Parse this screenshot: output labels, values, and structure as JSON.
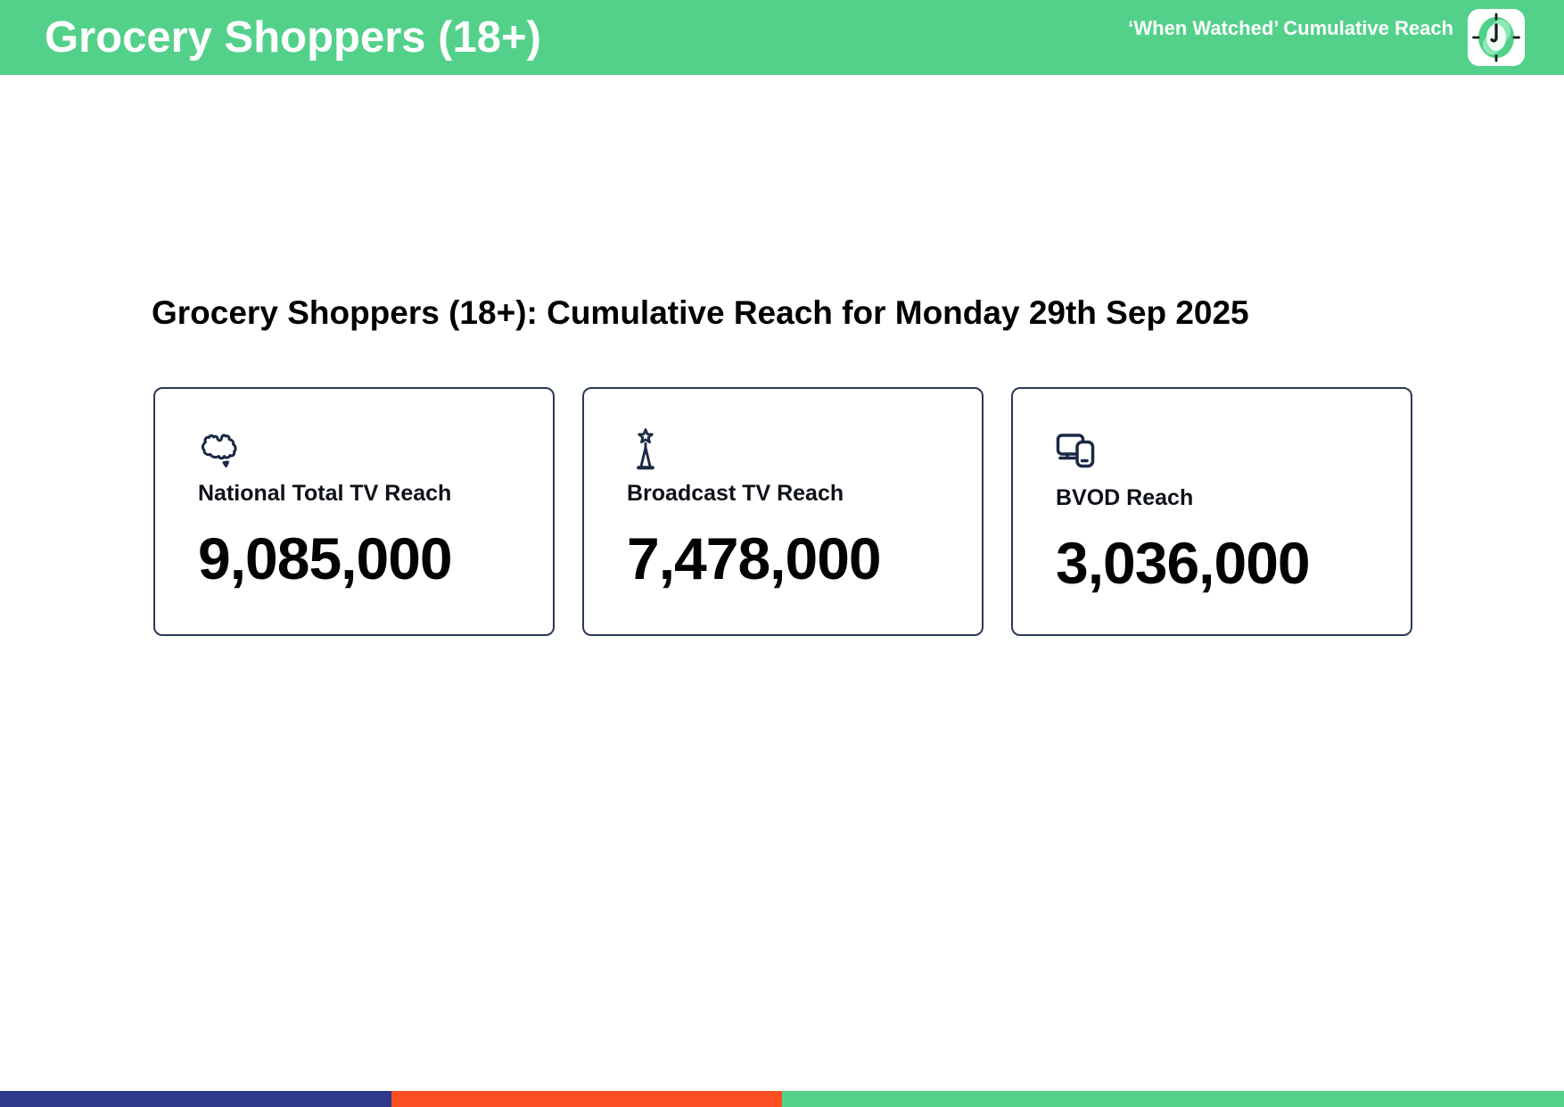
{
  "header": {
    "title": "Grocery Shoppers (18+)",
    "subtitle": "‘When Watched’ Cumulative Reach",
    "logo_icon": "clock-icon"
  },
  "main": {
    "title": "Grocery Shoppers (18+): Cumulative Reach for Monday 29th Sep 2025",
    "cards": [
      {
        "icon": "australia-map-icon",
        "label": "National Total TV Reach",
        "value": "9,085,000"
      },
      {
        "icon": "broadcast-tower-icon",
        "label": "Broadcast TV Reach",
        "value": "7,478,000"
      },
      {
        "icon": "devices-icon",
        "label": "BVOD Reach",
        "value": "3,036,000"
      }
    ]
  },
  "footer": {
    "segments": [
      {
        "name": "navy",
        "color": "#2d3a8c",
        "width_percent": 25
      },
      {
        "name": "orange",
        "color": "#fb4f23",
        "width_percent": 25
      },
      {
        "name": "green",
        "color": "#53d18a",
        "width_percent": 50
      }
    ]
  },
  "colors": {
    "header_bg": "#53d18a",
    "card_border": "#2b3a55",
    "icon_ink": "#1b2945",
    "logo_disc": "#4ed188",
    "logo_disc_light": "#8ee7b6",
    "logo_disc_pale": "#f2fdf6",
    "text_primary": "#000000"
  }
}
